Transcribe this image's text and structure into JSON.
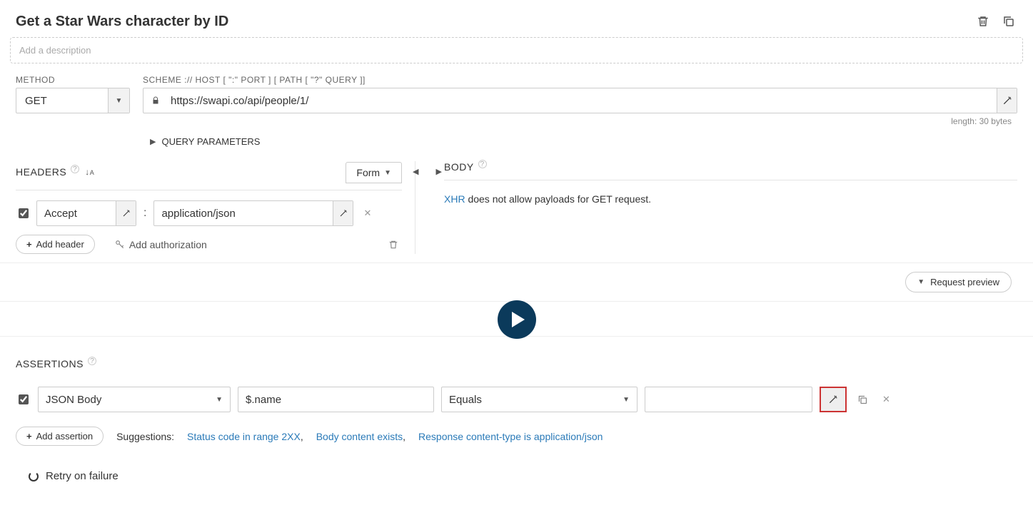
{
  "title": "Get a Star Wars character by ID",
  "description_placeholder": "Add a description",
  "method": {
    "label": "METHOD",
    "value": "GET"
  },
  "url": {
    "label": "SCHEME :// HOST [ \":\" PORT ] [ PATH [ \"?\" QUERY ]]",
    "value": "https://swapi.co/api/people/1/",
    "length_text": "length: 30 bytes"
  },
  "query_params_label": "QUERY PARAMETERS",
  "headers": {
    "title": "HEADERS",
    "form_toggle": "Form",
    "rows": [
      {
        "enabled": true,
        "name": "Accept",
        "value": "application/json"
      }
    ],
    "add_header": "Add header",
    "add_authorization": "Add authorization"
  },
  "body": {
    "title": "BODY",
    "xhr_label": "XHR",
    "message_rest": " does not allow payloads for GET request."
  },
  "request_preview": "Request preview",
  "assertions": {
    "title": "ASSERTIONS",
    "row": {
      "enabled": true,
      "source": "JSON Body",
      "path": "$.name",
      "operator": "Equals",
      "expected": ""
    },
    "add_assertion": "Add assertion",
    "suggestions_label": "Suggestions:",
    "suggestions": [
      "Status code in range 2XX",
      "Body content exists",
      "Response content-type is application/json"
    ]
  },
  "retry_label": "Retry on failure"
}
